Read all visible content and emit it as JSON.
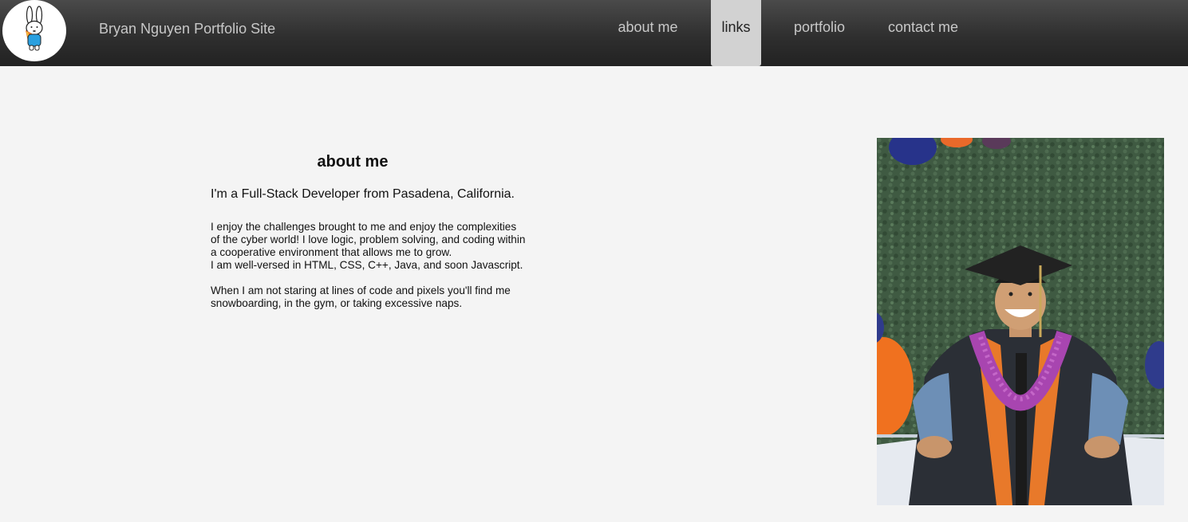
{
  "header": {
    "site_title": "Bryan Nguyen Portfolio Site",
    "logo_icon": "bunny-icon"
  },
  "nav": {
    "items": [
      {
        "label": "about me"
      },
      {
        "label": "links",
        "active": true
      },
      {
        "label": "portfolio"
      },
      {
        "label": "contact me"
      }
    ]
  },
  "about": {
    "heading": "about me",
    "intro": "I'm a Full-Stack Developer from Pasadena, California.",
    "paragraph1_lines": [
      "I enjoy the challenges brought to me and enjoy the complexities",
      "of the cyber world! I love logic, problem solving, and coding within",
      "a cooperative environment that allows me to grow.",
      "I am well-versed in HTML, CSS, C++, Java, and soon Javascript."
    ],
    "paragraph2_lines": [
      "When I am not staring at lines of code and pixels you'll find me",
      "snowboarding, in the gym, or taking excessive naps."
    ]
  },
  "colors": {
    "navbar_top": "#4a4a4a",
    "navbar_bottom": "#222222",
    "nav_text": "#c8c8c8",
    "nav_active_bg": "#d2d2d2",
    "page_bg": "#f4f4f4"
  }
}
